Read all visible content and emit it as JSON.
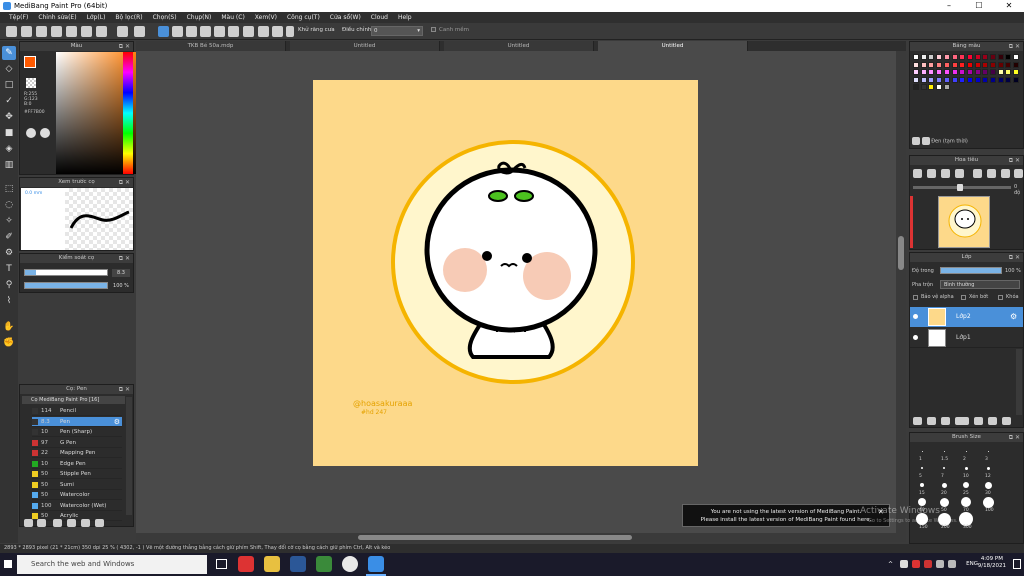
{
  "window": {
    "title": "MediBang Paint Pro (64bit)",
    "minimize": "–",
    "maximize": "☐",
    "close": "✕"
  },
  "menu": [
    "Tệp(F)",
    "Chỉnh sửa(E)",
    "Lớp(L)",
    "Bộ lọc(R)",
    "Chọn(S)",
    "Chụp(N)",
    "Màu (C)",
    "Xem(V)",
    "Công cụ(T)",
    "Cửa sổ(W)",
    "Cloud",
    "Help"
  ],
  "toolbar": {
    "antialias_label": "Khử răng cưa",
    "correction_label": "Điều chỉnh",
    "correction_value": "0",
    "snap_label": "Canh mềm"
  },
  "panels": {
    "color": {
      "title": "Màu",
      "rgb": [
        "R:255",
        "G:123",
        "B:0"
      ],
      "hex": "#FF7B00",
      "fg": "#ff5a00"
    },
    "brush_preview": {
      "title": "Xem trước cọ",
      "size": "0.0 mm"
    },
    "brush_control": {
      "title": "Kiểm soát cọ",
      "size_value": "8.3",
      "opacity_value": "100 %"
    },
    "brush_list": {
      "title": "Cọ: Pen",
      "group": "Cọ MediBang Paint Pro [16]",
      "items": [
        {
          "num": "114",
          "name": "Pencil",
          "color": "#333333"
        },
        {
          "num": "8.3",
          "name": "Pen",
          "color": "#333333"
        },
        {
          "num": "10",
          "name": "Pen (Sharp)",
          "color": "#333333"
        },
        {
          "num": "97",
          "name": "G Pen",
          "color": "#cc3333"
        },
        {
          "num": "22",
          "name": "Mapping Pen",
          "color": "#cc3333"
        },
        {
          "num": "10",
          "name": "Edge Pen",
          "color": "#22aa22"
        },
        {
          "num": "50",
          "name": "Stipple Pen",
          "color": "#eecc22"
        },
        {
          "num": "50",
          "name": "Sumi",
          "color": "#eecc22"
        },
        {
          "num": "50",
          "name": "Watercolor",
          "color": "#55aaee"
        },
        {
          "num": "100",
          "name": "Watercolor (Wet)",
          "color": "#55aaee"
        },
        {
          "num": "50",
          "name": "Acrylic",
          "color": "#eecc22"
        }
      ]
    },
    "palette": {
      "title": "Bảng màu",
      "selected": "Đen (tạm thời)"
    },
    "navigator": {
      "title": "Hoa tiêu",
      "zoom": "0 độ"
    },
    "layers": {
      "title": "Lớp",
      "opacity_label": "Độ trong",
      "opacity_value": "100 %",
      "blend_label": "Pha trộn",
      "blend_value": "Bình thường",
      "protect_alpha": "Bảo vệ alpha",
      "clip": "Xén bớt",
      "lock": "Khóa",
      "items": [
        {
          "name": "Lớp2"
        },
        {
          "name": "Lớp1"
        }
      ]
    },
    "brush_size": {
      "title": "Brush Size",
      "labels": [
        "1",
        "1.5",
        "2",
        "3",
        "5",
        "7",
        "10",
        "12",
        "15",
        "20",
        "25",
        "30",
        "40",
        "50",
        "70",
        "100",
        "150",
        "200",
        "300"
      ]
    }
  },
  "tabs": [
    "TKB Bé 50a.mdp",
    "Untitled",
    "Untitled",
    "Untitled"
  ],
  "artwork": {
    "watermark": "@hoasakuraaa",
    "tag": "#hd 247"
  },
  "notification": {
    "line1": "You are not using the latest version of MediBang Paint.",
    "line2": "Please install the latest version of MediBang Paint found here."
  },
  "activate": {
    "line1": "Activate Windows",
    "line2": "Go to Settings to activate Windows."
  },
  "status": "2893 * 2893 pixel  (21 * 21cm)  350 dpi  25 %  ( 4302, -1 )  Vẽ một đường thẳng bằng cách giữ phím Shift, Thay đổi cỡ cọ bằng cách giữ phím Ctrl, Alt và kéo",
  "taskbar": {
    "search": "Search the web and Windows",
    "lang": "ENG",
    "time": "4:09 PM",
    "date": "9/18/2021"
  }
}
